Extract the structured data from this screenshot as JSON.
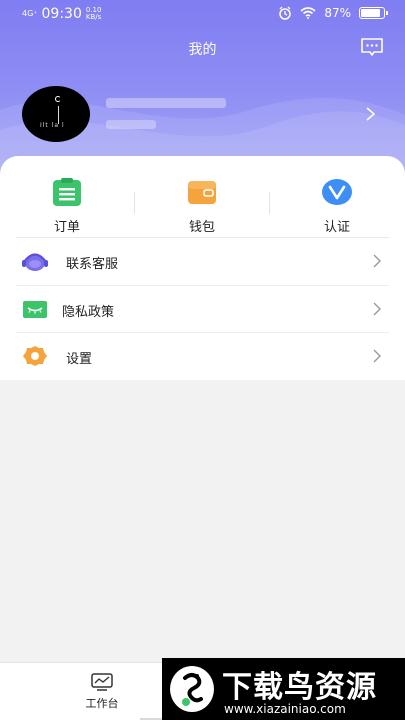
{
  "status_bar": {
    "signal": "4G⁺",
    "time": "09:30",
    "speed": "0.10 KB/s",
    "battery_text": "87%",
    "battery_level": 0.87,
    "icons": [
      "signal-icon",
      "alarm-icon",
      "wifi-icon",
      "battery-icon"
    ]
  },
  "header": {
    "title": "我的",
    "message_icon": "message-icon",
    "gradient_top": "#7f7df2",
    "gradient_bottom": "#a5a6f6"
  },
  "profile": {
    "avatar_text": "Ilt la l",
    "arrow_icon": "chevron-right-icon"
  },
  "quick_actions": [
    {
      "label": "订单",
      "icon": "order-icon",
      "color": "#3cc46a"
    },
    {
      "label": "钱包",
      "icon": "wallet-icon",
      "color": "#f5a33d"
    },
    {
      "label": "认证",
      "icon": "verify-icon",
      "color": "#3d8ff5"
    }
  ],
  "menu": [
    {
      "label": "联系客服",
      "icon": "headset-icon",
      "color": "#7a6ef0"
    },
    {
      "label": "隐私政策",
      "icon": "privacy-eye-icon",
      "color": "#3cc46a"
    },
    {
      "label": "设置",
      "icon": "gear-icon",
      "color": "#f5a33d"
    }
  ],
  "tabbar": {
    "tabs": [
      {
        "label": "工作台",
        "icon": "workbench-icon"
      }
    ]
  },
  "watermark": {
    "title": "下载鸟资源",
    "url": "www.xiazainiao.com"
  }
}
